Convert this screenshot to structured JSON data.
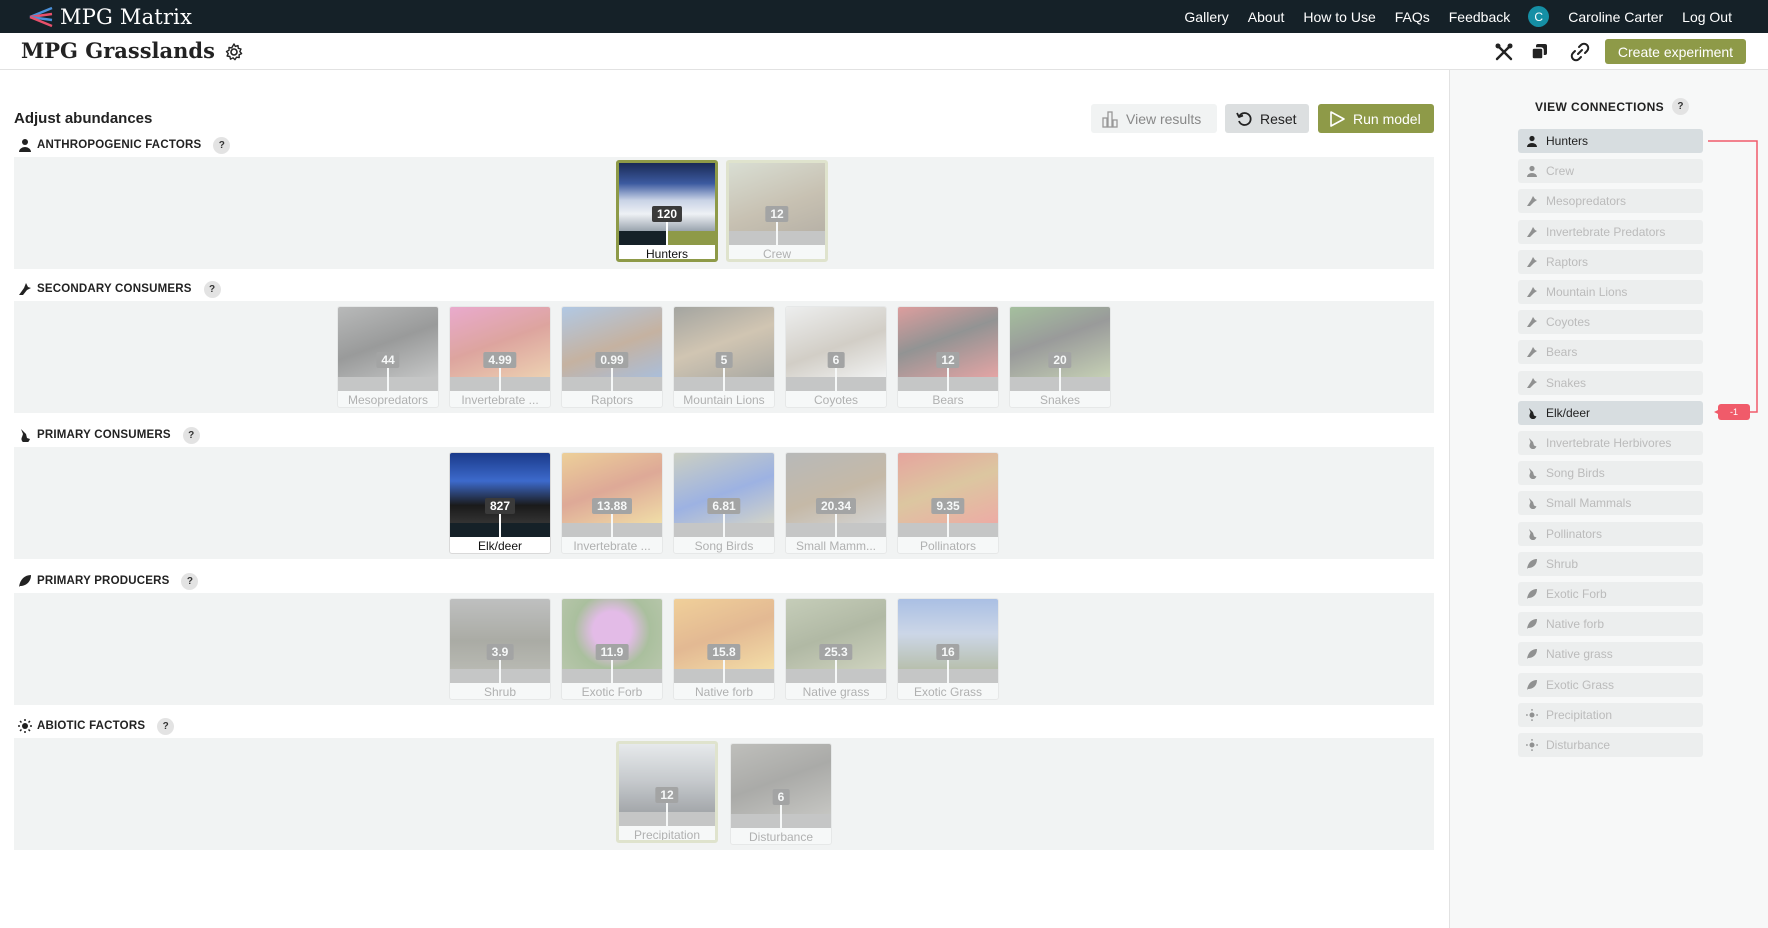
{
  "app": {
    "name": "MPG Matrix"
  },
  "nav": {
    "links": [
      "Gallery",
      "About",
      "How to Use",
      "FAQs",
      "Feedback"
    ],
    "avatar_initial": "C",
    "user_name": "Caroline Carter",
    "logout": "Log Out"
  },
  "header": {
    "title": "MPG Grasslands",
    "create_label": "Create experiment"
  },
  "main": {
    "title": "Adjust abundances",
    "view_results": "View results",
    "reset": "Reset",
    "run_model": "Run model"
  },
  "sections": [
    {
      "title": "ANTHROPOGENIC FACTORS",
      "icon": "person-icon",
      "qmark": "?",
      "items": [
        {
          "label": "Hunters",
          "value": "120"
        },
        {
          "label": "Crew",
          "value": "12"
        }
      ]
    },
    {
      "title": "SECONDARY CONSUMERS",
      "icon": "wolf-icon",
      "qmark": "?",
      "items": [
        {
          "label": "Mesopredators",
          "value": "44"
        },
        {
          "label": "Invertebrate ...",
          "value": "4.99"
        },
        {
          "label": "Raptors",
          "value": "0.99"
        },
        {
          "label": "Mountain Lions",
          "value": "5"
        },
        {
          "label": "Coyotes",
          "value": "6"
        },
        {
          "label": "Bears",
          "value": "12"
        },
        {
          "label": "Snakes",
          "value": "20"
        }
      ]
    },
    {
      "title": "PRIMARY CONSUMERS",
      "icon": "rabbit-icon",
      "qmark": "?",
      "items": [
        {
          "label": "Elk/deer",
          "value": "827"
        },
        {
          "label": "Invertebrate ...",
          "value": "13.88"
        },
        {
          "label": "Song Birds",
          "value": "6.81"
        },
        {
          "label": "Small Mamm...",
          "value": "20.34"
        },
        {
          "label": "Pollinators",
          "value": "9.35"
        }
      ]
    },
    {
      "title": "PRIMARY PRODUCERS",
      "icon": "leaf-icon",
      "qmark": "?",
      "items": [
        {
          "label": "Shrub",
          "value": "3.9"
        },
        {
          "label": "Exotic Forb",
          "value": "11.9"
        },
        {
          "label": "Native forb",
          "value": "15.8"
        },
        {
          "label": "Native grass",
          "value": "25.3"
        },
        {
          "label": "Exotic Grass",
          "value": "16"
        }
      ]
    },
    {
      "title": "ABIOTIC FACTORS",
      "icon": "sun-icon",
      "qmark": "?",
      "items": [
        {
          "label": "Precipitation",
          "value": "12"
        },
        {
          "label": "Disturbance",
          "value": "6"
        }
      ]
    }
  ],
  "sidebar": {
    "title": "VIEW CONNECTIONS",
    "qmark": "?",
    "connections": [
      {
        "label": "Hunters",
        "icon": "person-icon"
      },
      {
        "label": "Crew",
        "icon": "person-icon"
      },
      {
        "label": "Mesopredators",
        "icon": "wolf-icon"
      },
      {
        "label": "Invertebrate Predators",
        "icon": "wolf-icon"
      },
      {
        "label": "Raptors",
        "icon": "wolf-icon"
      },
      {
        "label": "Mountain Lions",
        "icon": "wolf-icon"
      },
      {
        "label": "Coyotes",
        "icon": "wolf-icon"
      },
      {
        "label": "Bears",
        "icon": "wolf-icon"
      },
      {
        "label": "Snakes",
        "icon": "wolf-icon"
      },
      {
        "label": "Elk/deer",
        "icon": "rabbit-icon"
      },
      {
        "label": "Invertebrate Herbivores",
        "icon": "rabbit-icon"
      },
      {
        "label": "Song Birds",
        "icon": "rabbit-icon"
      },
      {
        "label": "Small Mammals",
        "icon": "rabbit-icon"
      },
      {
        "label": "Pollinators",
        "icon": "rabbit-icon"
      },
      {
        "label": "Shrub",
        "icon": "leaf-icon"
      },
      {
        "label": "Exotic Forb",
        "icon": "leaf-icon"
      },
      {
        "label": "Native forb",
        "icon": "leaf-icon"
      },
      {
        "label": "Native grass",
        "icon": "leaf-icon"
      },
      {
        "label": "Exotic Grass",
        "icon": "leaf-icon"
      },
      {
        "label": "Precipitation",
        "icon": "sun-icon"
      },
      {
        "label": "Disturbance",
        "icon": "sun-icon"
      }
    ],
    "edge_value": "-1"
  },
  "colors": {
    "accent": "#8e9a48",
    "nav_bg": "#152128",
    "negative": "#f05b6a"
  }
}
